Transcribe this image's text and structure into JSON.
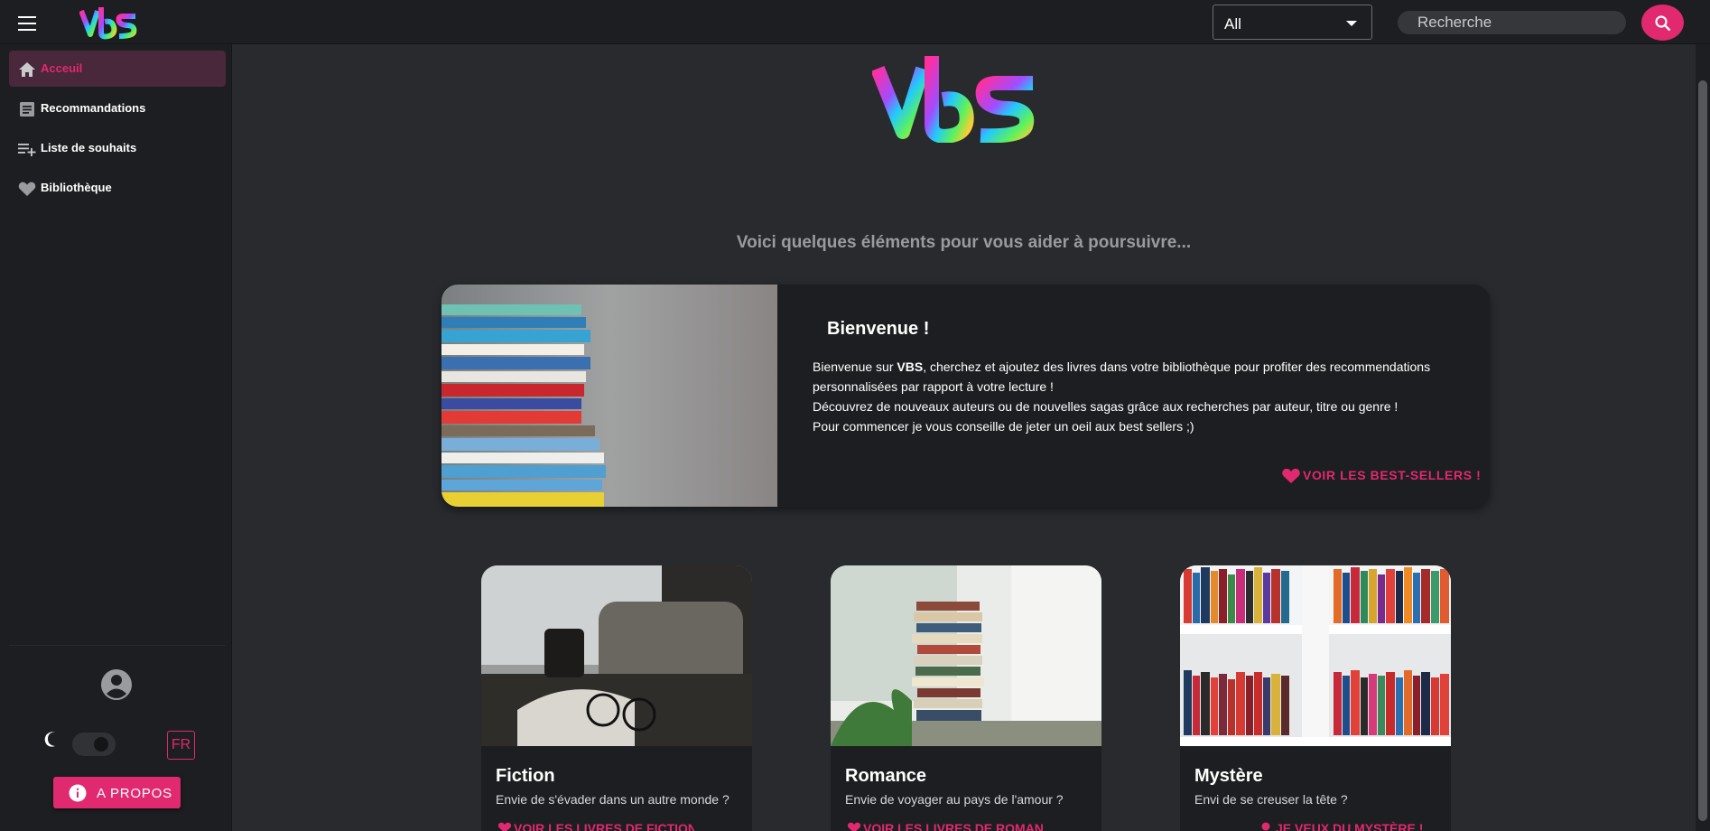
{
  "header": {
    "logo_text": "VBS",
    "filter_value": "All",
    "search_placeholder": "Recherche"
  },
  "sidebar": {
    "items": [
      {
        "label": "Acceuil",
        "icon": "home-icon",
        "active": true
      },
      {
        "label": "Recommandations",
        "icon": "article-icon",
        "active": false
      },
      {
        "label": "Liste de souhaits",
        "icon": "playlist-add-icon",
        "active": false
      },
      {
        "label": "Bibliothèque",
        "icon": "heart-icon",
        "active": false
      }
    ],
    "footer": {
      "language": "FR",
      "about_label": "A PROPOS",
      "dark_mode": true
    }
  },
  "main": {
    "logo_text": "VBS",
    "intro": "Voici quelques éléments pour vous aider à poursuivre...",
    "welcome": {
      "title": "Bienvenue !",
      "line1_pre": "Bienvenue sur ",
      "line1_bold": "VBS",
      "line1_post": ", cherchez et ajoutez des livres dans votre bibliothèque pour profiter des recommendations personnalisées par rapport à votre lecture !",
      "line2": "Découvrez de nouveaux auteurs ou de nouvelles sagas grâce aux recherches par auteur, titre ou genre !",
      "line3": "Pour commencer je vous conseille de jeter un oeil aux best sellers ;)",
      "cta": "VOIR LES BEST-SELLERS !"
    },
    "genres": [
      {
        "title": "Fiction",
        "subtitle": "Envie de s'évader dans un autre monde ?",
        "cta": "VOIR LES LIVRES DE FICTION !"
      },
      {
        "title": "Romance",
        "subtitle": "Envie de voyager au pays de l'amour ?",
        "cta": "VOIR LES LIVRES DE ROMANCE !"
      },
      {
        "title": "Mystère",
        "subtitle": "Envi de se creuser la tête ?",
        "cta": "JE VEUX DU MYSTÈRE !"
      }
    ]
  },
  "colors": {
    "accent": "#e0296f",
    "background": "#282a2e",
    "surface": "#1d1e21"
  }
}
